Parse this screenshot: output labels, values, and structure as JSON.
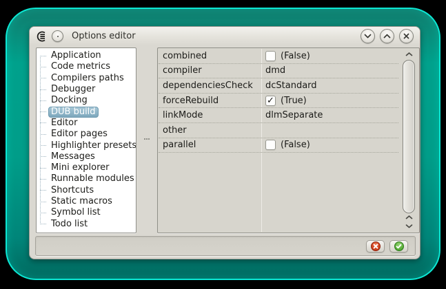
{
  "titlebar": {
    "title": "Options editor"
  },
  "sidebar": {
    "selected_item": "DUB build",
    "items": [
      {
        "label": "Application"
      },
      {
        "label": "Code metrics"
      },
      {
        "label": "Compilers paths"
      },
      {
        "label": "Debugger"
      },
      {
        "label": "Docking"
      },
      {
        "label": "DUB build"
      },
      {
        "label": "Editor"
      },
      {
        "label": "Editor pages"
      },
      {
        "label": "Highlighter presets"
      },
      {
        "label": "Messages"
      },
      {
        "label": "Mini explorer"
      },
      {
        "label": "Runnable modules"
      },
      {
        "label": "Shortcuts"
      },
      {
        "label": "Static macros"
      },
      {
        "label": "Symbol list"
      },
      {
        "label": "Todo list"
      }
    ]
  },
  "grid": {
    "rows": [
      {
        "name": "combined",
        "value": "(False)",
        "type": "bool",
        "checked": false,
        "mark": ""
      },
      {
        "name": "compiler",
        "value": "dmd",
        "type": "text"
      },
      {
        "name": "dependenciesCheck",
        "value": "dcStandard",
        "type": "text"
      },
      {
        "name": "forceRebuild",
        "value": "(True)",
        "type": "bool",
        "checked": true,
        "mark": "✓"
      },
      {
        "name": "linkMode",
        "value": "dlmSeparate",
        "type": "text"
      },
      {
        "name": "other",
        "value": "",
        "type": "text"
      },
      {
        "name": "parallel",
        "value": "(False)",
        "type": "bool",
        "checked": false,
        "mark": ""
      }
    ]
  },
  "colors": {
    "frame_teal": "#009d89",
    "frame_border_cyan": "#0ce8d4",
    "window_bg": "#dad8d1",
    "selected_item_bg": "#7ca7bc",
    "cancel_red": "#bb2d0b",
    "ok_green": "#3f9a26"
  }
}
